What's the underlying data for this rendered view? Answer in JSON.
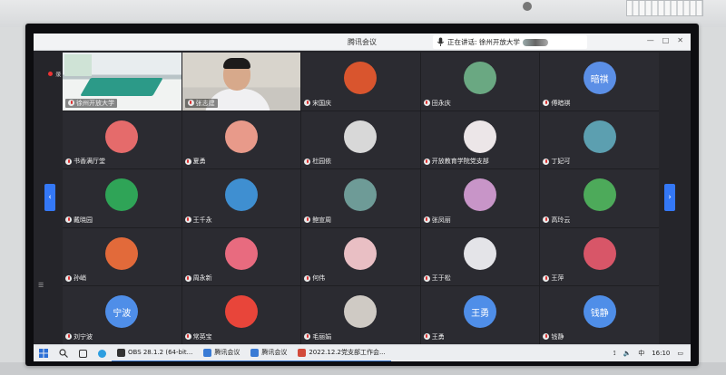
{
  "app": {
    "title": "腾讯会议",
    "speaking_label": "正在讲话: 徐州开放大学"
  },
  "window_controls": [
    "—",
    "□",
    "✕"
  ],
  "recording_label": "录",
  "side_list_icon": "☰",
  "colors": {
    "accent": "#3478f6",
    "tile_bg": "#2b2b31",
    "screen_bg": "#25252a"
  },
  "participants": [
    {
      "name": "徐州开放大学",
      "type": "video-room"
    },
    {
      "name": "张志建",
      "type": "video-person"
    },
    {
      "name": "宋国庆",
      "color": "#d9552e",
      "avatar_text": ""
    },
    {
      "name": "田永庆",
      "color": "#6aa882",
      "avatar_text": ""
    },
    {
      "name": "傅暗祺",
      "color": "#5b8fe6",
      "avatar_text": "暗祺"
    },
    {
      "name": "书香满厅堂",
      "color": "#e56b6b",
      "avatar_text": ""
    },
    {
      "name": "夏勇",
      "color": "#e89a8a",
      "avatar_text": ""
    },
    {
      "name": "杜园依",
      "color": "#d8d8d8",
      "avatar_text": ""
    },
    {
      "name": "开放教育学院党支部",
      "color": "#ece6e8",
      "avatar_text": ""
    },
    {
      "name": "丁妃可",
      "color": "#5c9fb0",
      "avatar_text": ""
    },
    {
      "name": "戴晓园",
      "color": "#2fa457",
      "avatar_text": ""
    },
    {
      "name": "王千永",
      "color": "#3f8fd1",
      "avatar_text": ""
    },
    {
      "name": "鲍宣周",
      "color": "#6e9b97",
      "avatar_text": ""
    },
    {
      "name": "张凤丽",
      "color": "#c895c8",
      "avatar_text": ""
    },
    {
      "name": "高玲云",
      "color": "#4daa5a",
      "avatar_text": ""
    },
    {
      "name": "孙峭",
      "color": "#e26a3a",
      "avatar_text": ""
    },
    {
      "name": "周永新",
      "color": "#e86b7f",
      "avatar_text": ""
    },
    {
      "name": "何伟",
      "color": "#e9bfc4",
      "avatar_text": ""
    },
    {
      "name": "王于松",
      "color": "#e4e4e8",
      "avatar_text": ""
    },
    {
      "name": "王萍",
      "color": "#d85668",
      "avatar_text": ""
    },
    {
      "name": "刘宁波",
      "color": "#4f8ee8",
      "avatar_text": "宁波"
    },
    {
      "name": "常英宝",
      "color": "#e8453a",
      "avatar_text": ""
    },
    {
      "name": "毛丽娟",
      "color": "#cfcac4",
      "avatar_text": ""
    },
    {
      "name": "王勇",
      "color": "#4f8ee8",
      "avatar_text": "王勇"
    },
    {
      "name": "钱静",
      "color": "#4f8ee8",
      "avatar_text": "钱静"
    }
  ],
  "taskbar": {
    "items": [
      {
        "label": "OBS 28.1.2 (64-bit...",
        "color": "#333"
      },
      {
        "label": "腾讯会议",
        "color": "#3a7bd5"
      },
      {
        "label": "腾讯会议",
        "color": "#3a7bd5"
      },
      {
        "label": "2022.12.2党支部工作会...",
        "color": "#d24a3a"
      }
    ],
    "ime": "中",
    "time": "16:10"
  }
}
